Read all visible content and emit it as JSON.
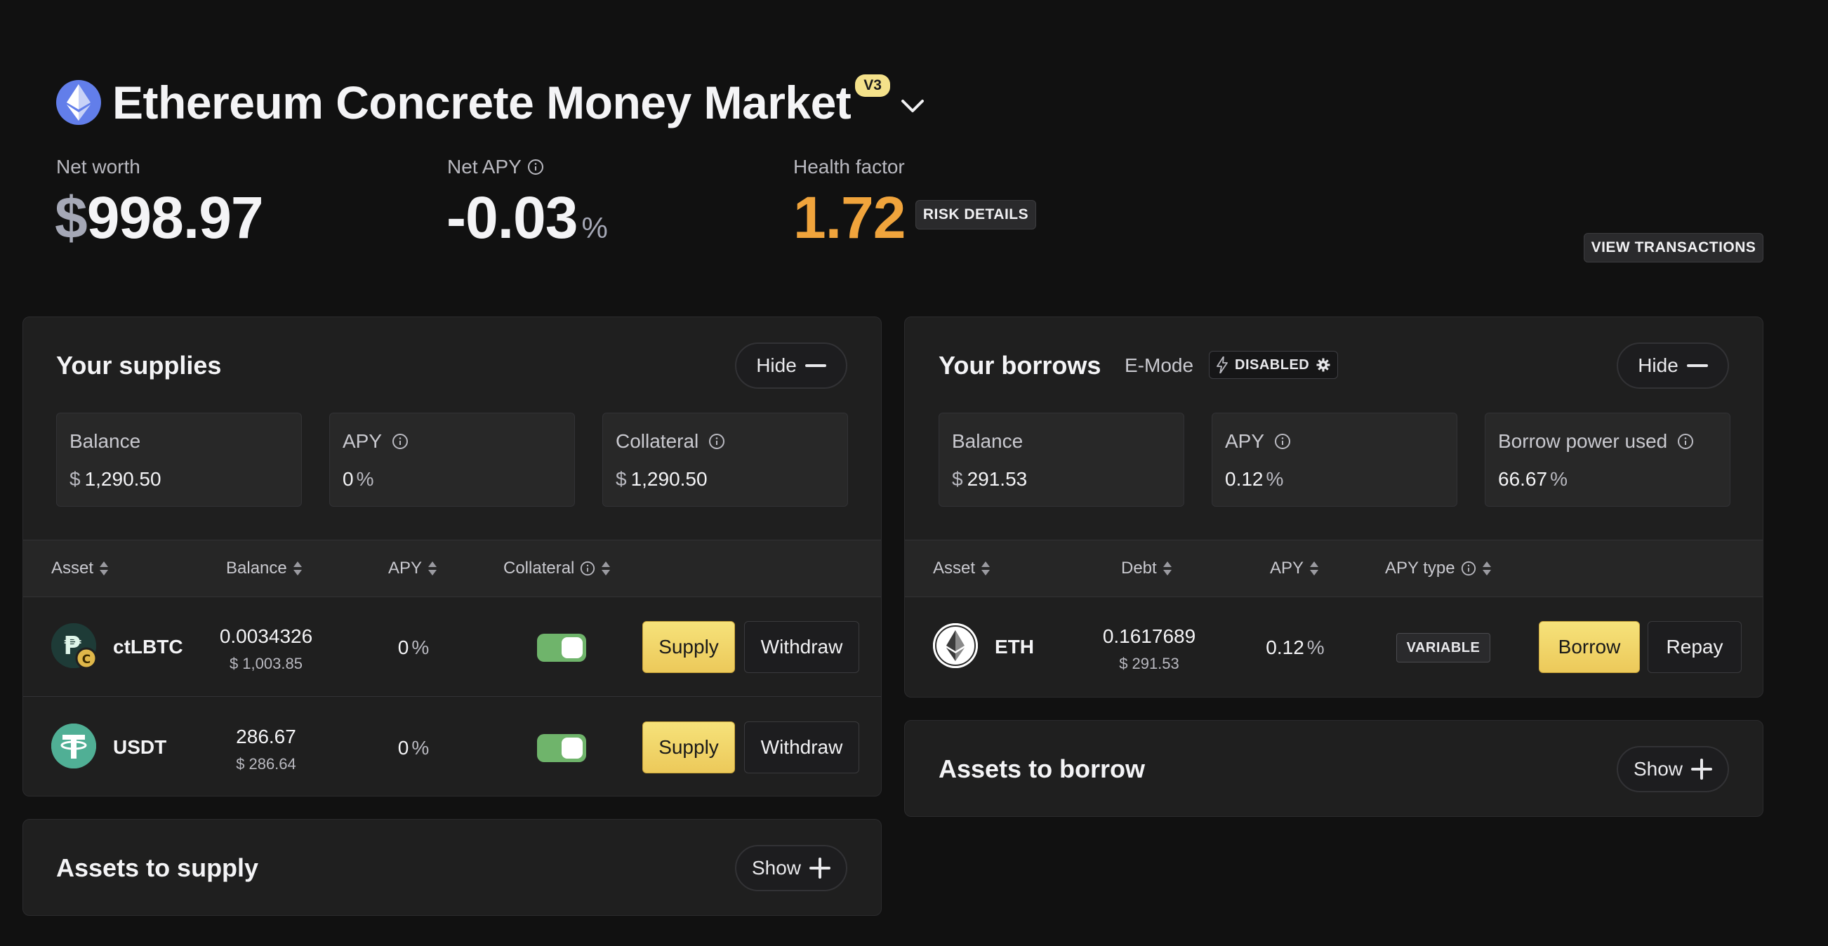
{
  "header": {
    "title": "Ethereum Concrete Money Market",
    "version": "V3",
    "icon": "ethereum-icon"
  },
  "stats": {
    "net_worth": {
      "label": "Net worth",
      "symbol": "$",
      "value": "998.97"
    },
    "net_apy": {
      "label": "Net APY",
      "value": "-0.03",
      "unit": "%"
    },
    "health_factor": {
      "label": "Health factor",
      "value": "1.72",
      "risk_button": "RISK DETAILS"
    },
    "view_transactions": "VIEW TRANSACTIONS"
  },
  "supplies": {
    "title": "Your supplies",
    "hide_label": "Hide",
    "summary": {
      "balance": {
        "label": "Balance",
        "prefix": "$",
        "value": "1,290.50"
      },
      "apy": {
        "label": "APY",
        "value": "0",
        "suffix": "%"
      },
      "collateral": {
        "label": "Collateral",
        "prefix": "$",
        "value": "1,290.50"
      }
    },
    "columns": [
      "Asset",
      "Balance",
      "APY",
      "Collateral"
    ],
    "rows": [
      {
        "asset": "ctLBTC",
        "balance": "0.0034326",
        "balance_usd_prefix": "$",
        "balance_usd": "1,003.85",
        "apy": "0",
        "apy_suffix": "%",
        "collateral_enabled": true,
        "supply_label": "Supply",
        "withdraw_label": "Withdraw"
      },
      {
        "asset": "USDT",
        "balance": "286.67",
        "balance_usd_prefix": "$",
        "balance_usd": "286.64",
        "apy": "0",
        "apy_suffix": "%",
        "collateral_enabled": true,
        "supply_label": "Supply",
        "withdraw_label": "Withdraw"
      }
    ]
  },
  "borrows": {
    "title": "Your borrows",
    "emode_label": "E-Mode",
    "emode_status": "DISABLED",
    "hide_label": "Hide",
    "summary": {
      "balance": {
        "label": "Balance",
        "prefix": "$",
        "value": "291.53"
      },
      "apy": {
        "label": "APY",
        "value": "0.12",
        "suffix": "%"
      },
      "borrow_power": {
        "label": "Borrow power used",
        "value": "66.67",
        "suffix": "%"
      }
    },
    "columns": [
      "Asset",
      "Debt",
      "APY",
      "APY type"
    ],
    "rows": [
      {
        "asset": "ETH",
        "debt": "0.1617689",
        "debt_usd_prefix": "$",
        "debt_usd": "291.53",
        "apy": "0.12",
        "apy_suffix": "%",
        "apy_type": "VARIABLE",
        "borrow_label": "Borrow",
        "repay_label": "Repay"
      }
    ]
  },
  "assets_to_supply": {
    "title": "Assets to supply",
    "show_label": "Show"
  },
  "assets_to_borrow": {
    "title": "Assets to borrow",
    "show_label": "Show"
  },
  "colors": {
    "background": "#111111",
    "panel": "#1f1f1f",
    "accent_yellow": "#f0d36a",
    "health_orange": "#f0a43c",
    "toggle_green": "#6fb46b",
    "eth_blue": "#627eea",
    "usdt_green": "#50af95"
  }
}
